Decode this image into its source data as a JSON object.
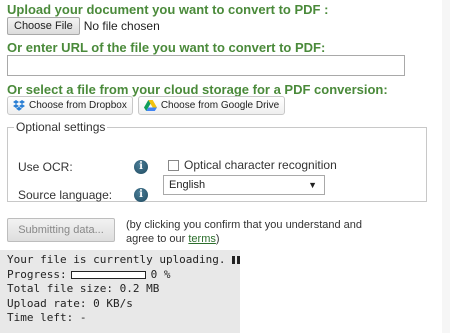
{
  "upload": {
    "heading": "Upload your document you want to convert to PDF :",
    "choose_file_label": "Choose File",
    "file_status": "No file chosen"
  },
  "url": {
    "heading": "Or enter URL of the file you want to convert to PDF:",
    "value": "",
    "placeholder": ""
  },
  "cloud": {
    "heading": "Or select a file from your cloud storage for a PDF conversion:",
    "dropbox_label": "Choose from Dropbox",
    "gdrive_label": "Choose from Google Drive",
    "dropbox_icon": "dropbox-icon",
    "gdrive_icon": "google-drive-icon"
  },
  "options": {
    "legend": "Optional settings",
    "ocr_label": "Use OCR:",
    "ocr_checkbox_label": "Optical character recognition",
    "ocr_checked": false,
    "source_language_label": "Source language:",
    "source_language_value": "English",
    "info_icon": "info-icon"
  },
  "submit": {
    "button_label": "Submitting data...",
    "consent_text": "(by clicking you confirm that you understand and agree to our ",
    "terms_link": "terms",
    "consent_close": ")"
  },
  "status": {
    "uploading_text": "Your file is currently uploading.",
    "progress_label": "Progress:",
    "progress_value": 0,
    "progress_text": "0 %",
    "total_size": "Total file size: 0.2 MB",
    "upload_rate": "Upload rate: 0 KB/s",
    "time_left": "Time left: -"
  },
  "colors": {
    "heading_green": "#4a8a3a",
    "link_green": "#2c6e2c"
  }
}
